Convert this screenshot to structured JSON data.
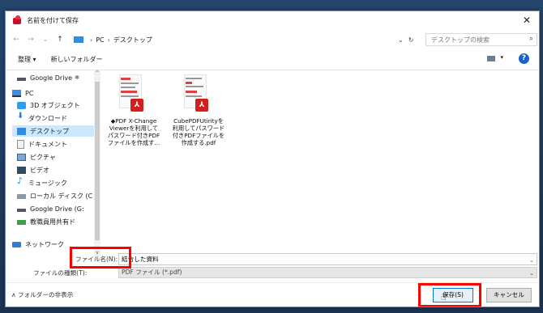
{
  "window": {
    "title": "名前を付けて保存",
    "close": "✕"
  },
  "nav": {
    "back": "←",
    "forward": "→",
    "recent": "⌄",
    "up": "↑",
    "path": [
      "PC",
      "デスクトップ"
    ],
    "path_sep": "›",
    "dropdown": "⌄",
    "refresh": "↻",
    "search_placeholder": "デスクトップの検索"
  },
  "toolbar": {
    "organize": "整理 ▾",
    "new_folder": "新しいフォルダー",
    "view_dd": "▾",
    "help": "?"
  },
  "sidebar": {
    "items": [
      {
        "label": "Google Drive",
        "icon": "drive-icon"
      },
      {
        "label": "PC",
        "icon": "pc-icon"
      },
      {
        "label": "3D オブジェクト",
        "icon": "3d-objects-icon"
      },
      {
        "label": "ダウンロード",
        "icon": "download-icon"
      },
      {
        "label": "デスクトップ",
        "icon": "desktop-icon"
      },
      {
        "label": "ドキュメント",
        "icon": "documents-icon"
      },
      {
        "label": "ピクチャ",
        "icon": "pictures-icon"
      },
      {
        "label": "ビデオ",
        "icon": "videos-icon"
      },
      {
        "label": "ミュージック",
        "icon": "music-icon"
      },
      {
        "label": "ローカル ディスク (C",
        "icon": "local-disk-icon"
      },
      {
        "label": "Google Drive (G:",
        "icon": "drive-icon"
      },
      {
        "label": "教職員用共有ド",
        "icon": "shared-drive-icon"
      },
      {
        "label": "ネットワーク",
        "icon": "network-icon"
      }
    ],
    "pin": "✱",
    "scroll_up": "^",
    "scroll_down": "v"
  },
  "files": [
    {
      "name_lines": [
        "◆PDF X-Change",
        "Viewerを利用して",
        "パスワード付きPDF",
        "ファイルを作成す..."
      ],
      "badge": "⅄"
    },
    {
      "name_lines": [
        "CubePDFUtirityを",
        "利用してパスワード",
        "付きPDFファイルを",
        "作成する.pdf"
      ],
      "badge": "⅄"
    }
  ],
  "form": {
    "filename_label": "ファイル名(N):",
    "filename_value": "結合した資料",
    "filetype_label": "ファイルの種類(T):",
    "filetype_value": "PDF ファイル (*.pdf)",
    "caret": "⌄"
  },
  "footer": {
    "hide_folders": "∧ フォルダーの非表示",
    "save": "保存(S)",
    "cancel": "キャンセル"
  },
  "colors": {
    "highlight": "#ff0000",
    "selected": "#cce8ff",
    "accent": "#0078d7"
  }
}
